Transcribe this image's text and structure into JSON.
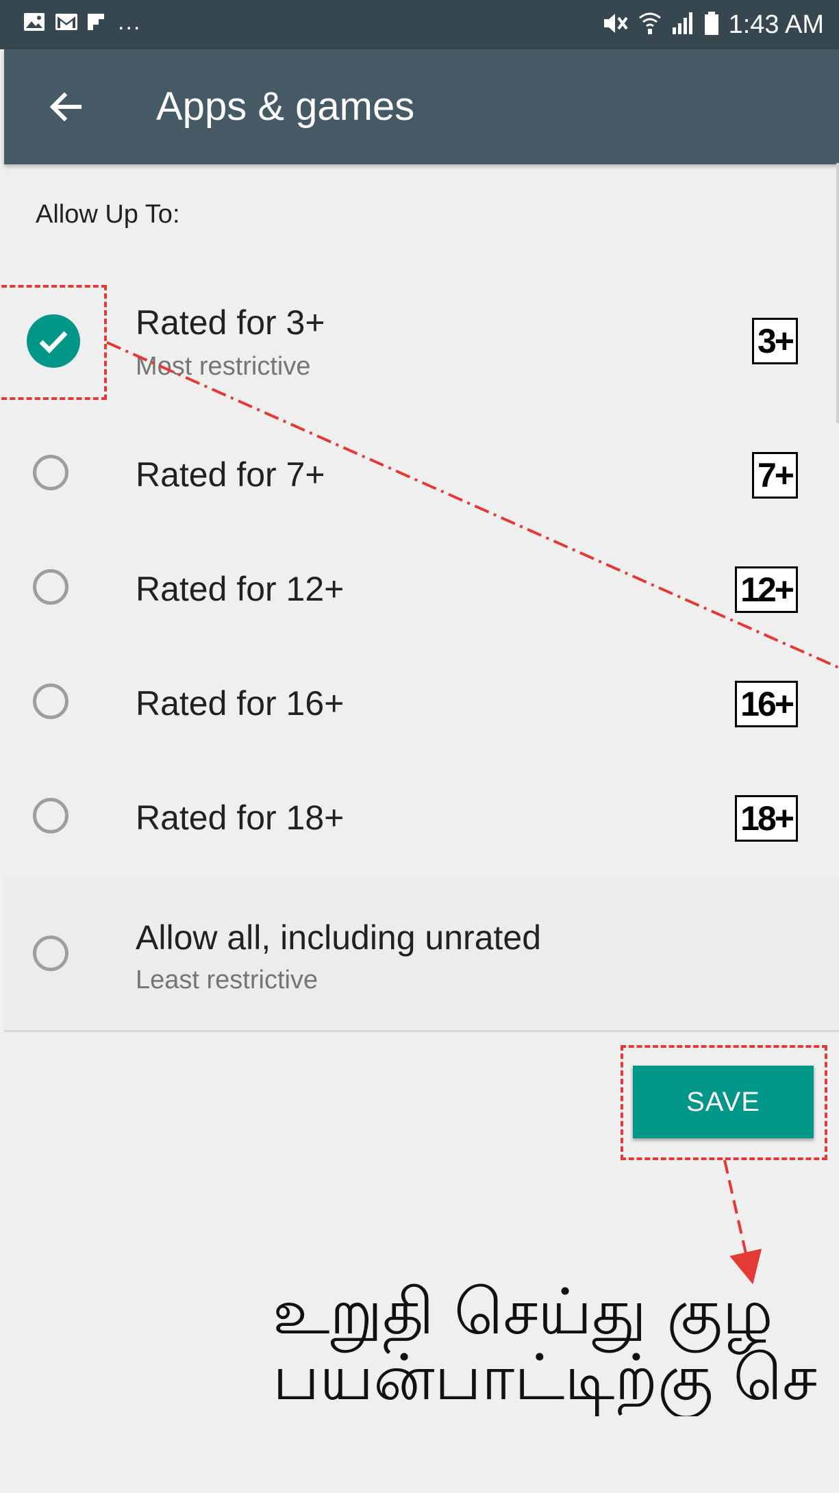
{
  "status_bar": {
    "notification_icons": [
      "image-icon",
      "gmail-icon",
      "flipboard-icon"
    ],
    "more": "...",
    "time": "1:43 AM"
  },
  "app_bar": {
    "title": "Apps & games"
  },
  "section_label": "Allow Up To:",
  "options": [
    {
      "title": "Rated for 3+",
      "subtitle": "Most restrictive",
      "badge": "3+",
      "selected": true
    },
    {
      "title": "Rated for 7+",
      "badge": "7+",
      "selected": false
    },
    {
      "title": "Rated for 12+",
      "badge": "12+",
      "selected": false
    },
    {
      "title": "Rated for 16+",
      "badge": "16+",
      "selected": false
    },
    {
      "title": "Rated for 18+",
      "badge": "18+",
      "selected": false
    },
    {
      "title": "Allow all, including unrated",
      "subtitle": "Least restrictive",
      "selected": false
    }
  ],
  "save_label": "SAVE",
  "caption": [
    "உறுதி செய்து குழ",
    "பயன்பாட்டிற்கு செ"
  ],
  "colors": {
    "accent": "#009688",
    "appbar": "#455a64",
    "statusbar": "#37474f",
    "annotation": "#e53935"
  }
}
